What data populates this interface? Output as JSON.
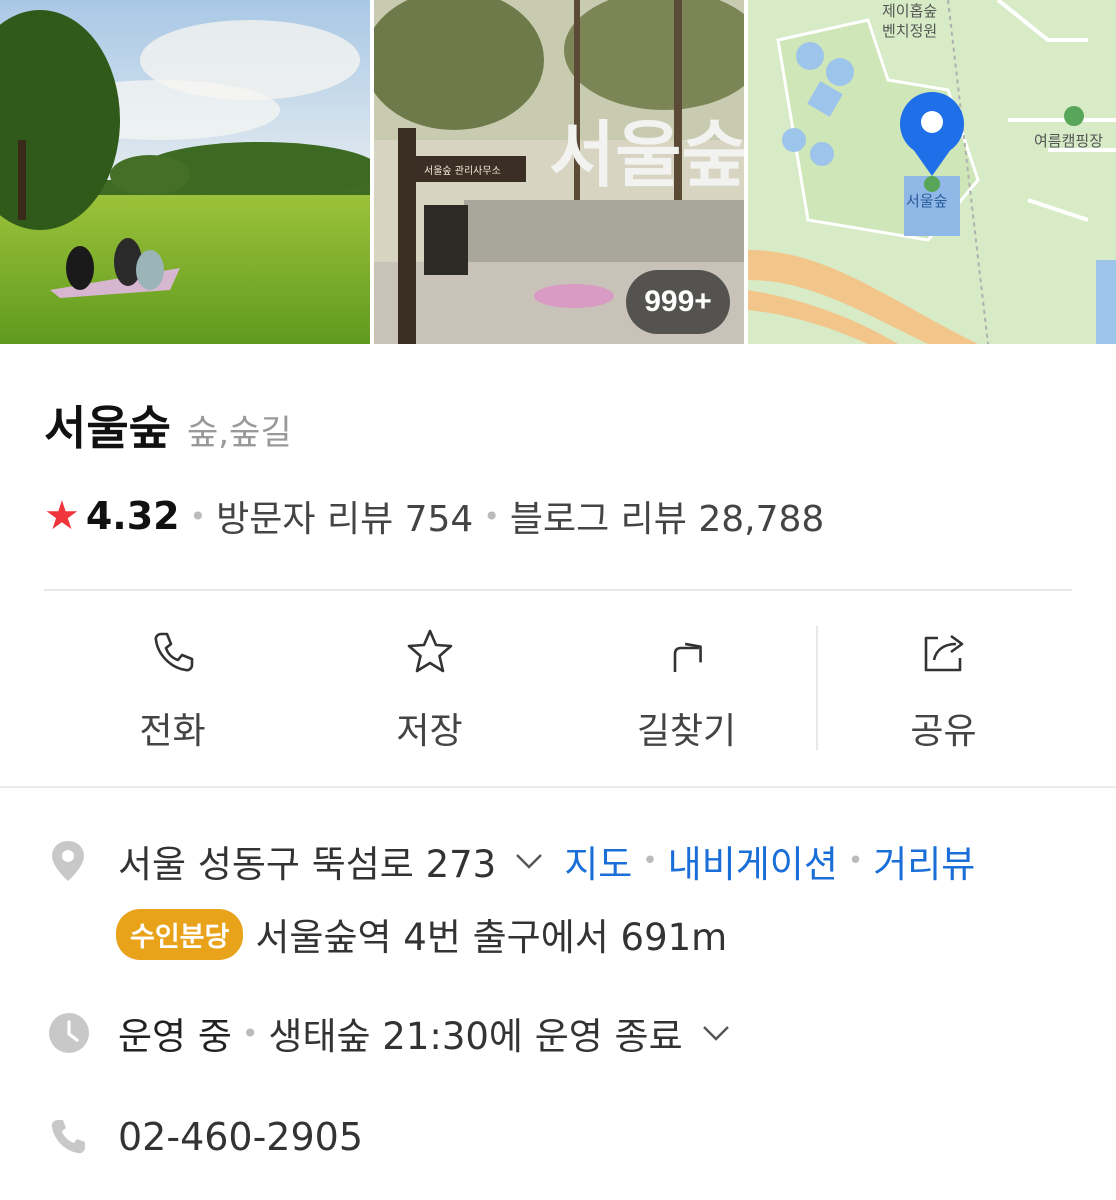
{
  "photos": {
    "count_badge": "999+",
    "sign_text": "서울숲",
    "signpost_text": "서울숲 관리사무소",
    "map_labels": {
      "top": "제이홉숲\n벤치정원",
      "top_line1": "제이홉숲",
      "top_line2": "벤치정원",
      "right": "여름캠핑장",
      "pin": "서울숲"
    }
  },
  "place": {
    "name": "서울숲",
    "category": "숲,숲길"
  },
  "rating": {
    "score": "4.32",
    "visitor_reviews": "방문자 리뷰 754",
    "blog_reviews": "블로그 리뷰 28,788"
  },
  "actions": [
    {
      "label": "전화",
      "icon": "phone-icon"
    },
    {
      "label": "저장",
      "icon": "star-outline-icon"
    },
    {
      "label": "길찾기",
      "icon": "directions-icon"
    },
    {
      "label": "공유",
      "icon": "share-icon"
    }
  ],
  "address": {
    "text": "서울 성동구 뚝섬로 273",
    "links": [
      "지도",
      "내비게이션",
      "거리뷰"
    ]
  },
  "subway": {
    "line": "수인분당",
    "text": "서울숲역 4번 출구에서 691m"
  },
  "hours": {
    "status": "운영 중",
    "text": "생태숲 21:30에 운영 종료"
  },
  "phone": {
    "number": "02-460-2905"
  },
  "colors": {
    "accent_blue": "#1a6ed8",
    "star_red": "#f0353d",
    "line_badge": "#e8a31b"
  }
}
